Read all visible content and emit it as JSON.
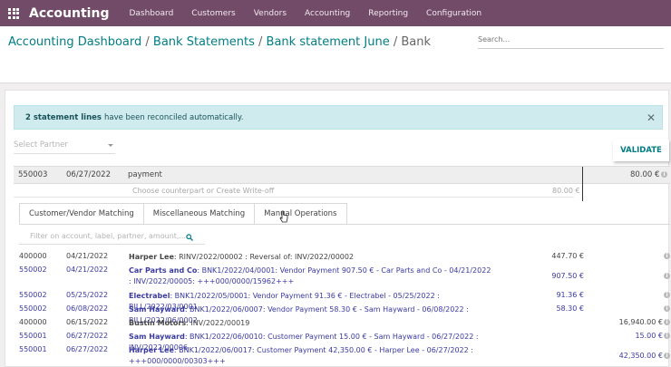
{
  "navbar": {
    "brand": "Accounting",
    "menu": [
      "Dashboard",
      "Customers",
      "Vendors",
      "Accounting",
      "Reporting",
      "Configuration"
    ]
  },
  "breadcrumb": {
    "items": [
      "Accounting Dashboard",
      "Bank Statements",
      "Bank statement June"
    ],
    "current": "Bank"
  },
  "search": {
    "placeholder": "Search..."
  },
  "alert": {
    "bold": "2 statement lines",
    "text": "have been reconciled automatically."
  },
  "partner": {
    "placeholder": "Select Partner"
  },
  "validate_label": "VALIDATE",
  "statement": {
    "account": "550003",
    "date": "06/27/2022",
    "label": "payment",
    "amount": "80.00 €",
    "counterpart_hint": "Choose counterpart or Create Write-off",
    "counterpart_amount": "80.00 €"
  },
  "tabs": [
    "Customer/Vendor Matching",
    "Miscellaneous Matching",
    "Manual Operations"
  ],
  "filter": {
    "placeholder": "Filter on account, label, partner, amount,..."
  },
  "rows": [
    {
      "account": "400000",
      "date": "04/21/2022",
      "partner": "Harper Lee",
      "desc": ": RINV/2022/00002 : Reversal of: INV/2022/00002",
      "amount": "447.70 €",
      "amount2": "",
      "style": "dark"
    },
    {
      "account": "550002",
      "date": "04/21/2022",
      "partner": "Car Parts and Co",
      "desc": ": BNK1/2022/04/0001: Vendor Payment 907.50 € - Car Parts and Co - 04/21/2022 : INV/2022/00005: +++000/0000/15962+++",
      "amount": "907.50 €",
      "amount2": "",
      "style": "blue"
    },
    {
      "account": "550002",
      "date": "05/25/2022",
      "partner": "Electrabel",
      "desc": ": BNK1/2022/05/0001: Vendor Payment 91.36 € - Electrabel - 05/25/2022 : BILL/2022/03/0001",
      "amount": "91.36 €",
      "amount2": "",
      "style": "blue"
    },
    {
      "account": "550002",
      "date": "06/08/2022",
      "partner": "Sam Hayward",
      "desc": ": BNK1/2022/06/0007: Vendor Payment 58.30 € - Sam Hayward - 06/08/2022 : BILL/2022/06/0002",
      "amount": "58.30 €",
      "amount2": "",
      "style": "blue"
    },
    {
      "account": "400000",
      "date": "06/15/2022",
      "partner": "Bustin Motors",
      "desc": ": INV/2022/00019",
      "amount": "",
      "amount2": "16,940.00 €",
      "style": "dark"
    },
    {
      "account": "550001",
      "date": "06/27/2022",
      "partner": "Sam Hayward",
      "desc": ": BNK1/2022/06/0010: Customer Payment 15.00 € - Sam Hayward - 06/27/2022 : INV/2022/00006",
      "amount": "",
      "amount2": "15.00 €",
      "style": "blue"
    },
    {
      "account": "550001",
      "date": "06/27/2022",
      "partner": "Harper Lee",
      "desc": ": BNK1/2022/06/0017: Customer Payment 42,350.00 € - Harper Lee - 06/27/2022 : +++000/0000/00303+++",
      "amount": "",
      "amount2": "42,350.00 €",
      "style": "blue"
    }
  ],
  "icons": {
    "apps": "apps-grid-icon",
    "close": "close-icon",
    "search": "search-icon",
    "info": "info-icon",
    "cursor": "pointer-cursor-icon"
  },
  "colors": {
    "navbar": "#714b67",
    "accent": "#017e84",
    "alert_bg": "#cfebee",
    "link": "#3a3aa0"
  }
}
